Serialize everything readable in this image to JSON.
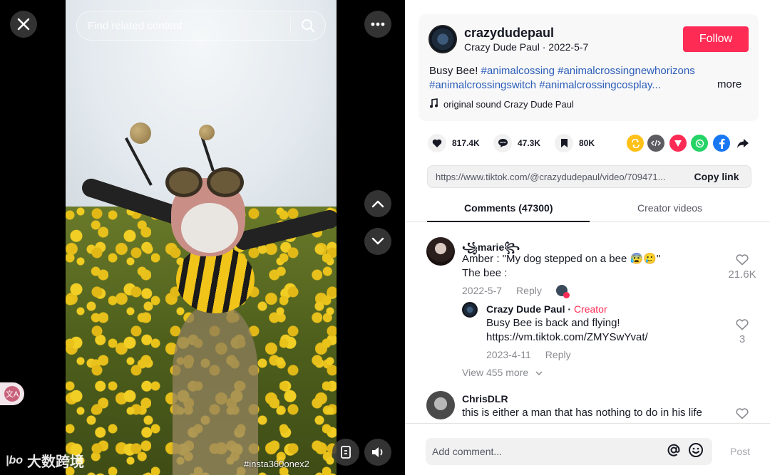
{
  "video": {
    "search_placeholder": "Find related content",
    "hashtag_overlay": "#insta360onex2",
    "side_badge": "文A",
    "watermark_logo": "|bo",
    "watermark_text": "大数跨境"
  },
  "author": {
    "username": "crazydudepaul",
    "display_name": "Crazy Dude Paul",
    "date": "2022-5-7",
    "separator": " · ",
    "follow_label": "Follow",
    "description_text": "Busy Bee! ",
    "hashtags": [
      "#animalcossing",
      "#animalcrossingnewhorizons",
      "#animalcrossingswitch",
      "#animalcrossingcosplay..."
    ],
    "more_label": "more",
    "music": "original sound Crazy Dude Paul"
  },
  "stats": {
    "likes": "817.4K",
    "comments": "47.3K",
    "saves": "80K"
  },
  "share_icons": [
    "repost-icon",
    "embed-icon",
    "send-icon",
    "whatsapp-icon",
    "facebook-icon",
    "share-arrow-icon"
  ],
  "link": {
    "url": "https://www.tiktok.com/@crazydudepaul/video/709471...",
    "copy_label": "Copy link"
  },
  "tabs": {
    "comments": "Comments (47300)",
    "creator_videos": "Creator videos"
  },
  "comments": [
    {
      "name": "꧁marie꧂",
      "text_line1": "Amber : \"My dog stepped on a bee 😰🥲\"",
      "text_line2": "The bee :",
      "date": "2022-5-7",
      "reply_label": "Reply",
      "likes": "21.6K",
      "reply": {
        "name": "Crazy Dude Paul",
        "creator_label": "Creator",
        "text_line1": "Busy Bee is back and flying!",
        "text_line2": "https://vm.tiktok.com/ZMYSwYvat/",
        "date": "2023-4-11",
        "reply_label": "Reply",
        "likes": "3"
      },
      "view_more": "View 455 more"
    },
    {
      "name": "ChrisDLR",
      "text_line1": "this is either a man that has nothing to do in his life"
    }
  ],
  "composer": {
    "placeholder": "Add comment...",
    "post_label": "Post"
  },
  "colors": {
    "accent": "#fe2c55",
    "hashtag": "#2b5db9",
    "muted": "#8a8b91"
  }
}
